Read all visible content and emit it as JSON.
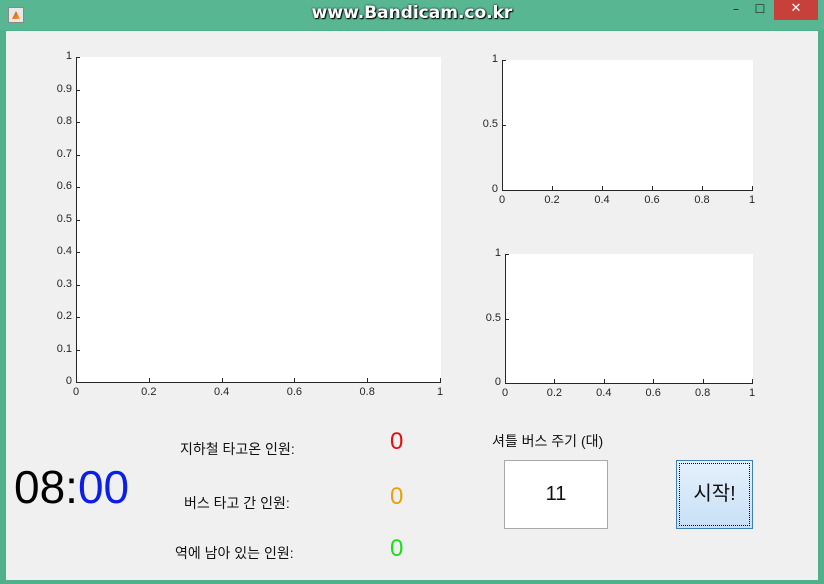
{
  "window": {
    "title": "www.Bandicam.co.kr",
    "minimize": "–",
    "maximize": "☐",
    "close": "✕"
  },
  "main_axes": {
    "yticks": [
      "0",
      "0.1",
      "0.2",
      "0.3",
      "0.4",
      "0.5",
      "0.6",
      "0.7",
      "0.8",
      "0.9",
      "1"
    ],
    "xticks": [
      "0",
      "0.2",
      "0.4",
      "0.6",
      "0.8",
      "1"
    ]
  },
  "top_right_axes": {
    "yticks": [
      "0",
      "0.5",
      "1"
    ],
    "xticks": [
      "0",
      "0.2",
      "0.4",
      "0.6",
      "0.8",
      "1"
    ]
  },
  "bottom_right_axes": {
    "yticks": [
      "0",
      "0.5",
      "1"
    ],
    "xticks": [
      "0",
      "0.2",
      "0.4",
      "0.6",
      "0.8",
      "1"
    ]
  },
  "chart_data": [
    {
      "type": "line",
      "series": [],
      "xlim": [
        0,
        1
      ],
      "ylim": [
        0,
        1
      ],
      "grid": false
    },
    {
      "type": "line",
      "series": [],
      "xlim": [
        0,
        1
      ],
      "ylim": [
        0,
        1
      ],
      "grid": false
    },
    {
      "type": "line",
      "series": [],
      "xlim": [
        0,
        1
      ],
      "ylim": [
        0,
        1
      ],
      "grid": false
    }
  ],
  "clock": {
    "hour": "08",
    "sep": ":",
    "minute": "00"
  },
  "stats": {
    "subway_label": "지하철 타고온 인원:",
    "subway_value": "0",
    "bus_label": "버스 타고 간 인원:",
    "bus_value": "0",
    "remain_label": "역에 남아 있는 인원:",
    "remain_value": "0"
  },
  "colors": {
    "subway": "#e01010",
    "bus": "#e8a100",
    "remain": "#18e018",
    "minute": "#0b1ee6"
  },
  "shuttle": {
    "label": "셔틀 버스 주기 (대)",
    "value": "11",
    "start_label": "시작!"
  }
}
